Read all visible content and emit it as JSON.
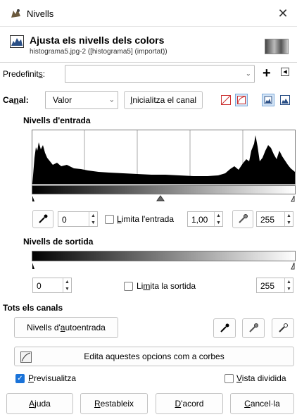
{
  "window": {
    "title": "Nivells",
    "close_glyph": "✕"
  },
  "header": {
    "title": "Ajusta els nivells dels colors",
    "subtitle": "histograma5.jpg-2 ([histograma5] (importat))"
  },
  "presets": {
    "label_pre": "Predefinit",
    "label_u": "s",
    "label_post": ":",
    "value": "",
    "add_glyph": "+",
    "menu_glyph": "◂"
  },
  "channel": {
    "label_pre": "Ca",
    "label_u": "n",
    "label_post": "al:",
    "value": "Valor",
    "reset_pre": "",
    "reset_u": "I",
    "reset_post": "nicialitza el canal"
  },
  "input_levels": {
    "title": "Nivells d'entrada",
    "low": "0",
    "gamma": "1,00",
    "high": "255",
    "clamp_pre": "",
    "clamp_u": "L",
    "clamp_post": "imita l'entrada"
  },
  "output_levels": {
    "title": "Nivells de sortida",
    "low": "0",
    "high": "255",
    "clamp_pre": "Li",
    "clamp_u": "m",
    "clamp_post": "ita la sortida"
  },
  "all_channels": {
    "title": "Tots els canals",
    "auto_pre": "Nivells d'",
    "auto_u": "a",
    "auto_post": "utoentrada"
  },
  "curves_button": "Edita aquestes opcions com a corbes",
  "preview": {
    "pre": "",
    "u": "P",
    "post": "revisualitza",
    "checked": true
  },
  "split": {
    "pre": "",
    "u": "V",
    "post": "ista dividida",
    "checked": false
  },
  "buttons": {
    "help": {
      "pre": "",
      "u": "A",
      "post": "juda"
    },
    "reset": {
      "pre": "",
      "u": "R",
      "post": "estableix"
    },
    "ok": {
      "pre": "",
      "u": "D",
      "post": "'acord"
    },
    "cancel": {
      "pre": "",
      "u": "C",
      "post": "ancel·la"
    }
  },
  "colors": {
    "accent": "#1a73d9",
    "histogram": "#000000"
  }
}
